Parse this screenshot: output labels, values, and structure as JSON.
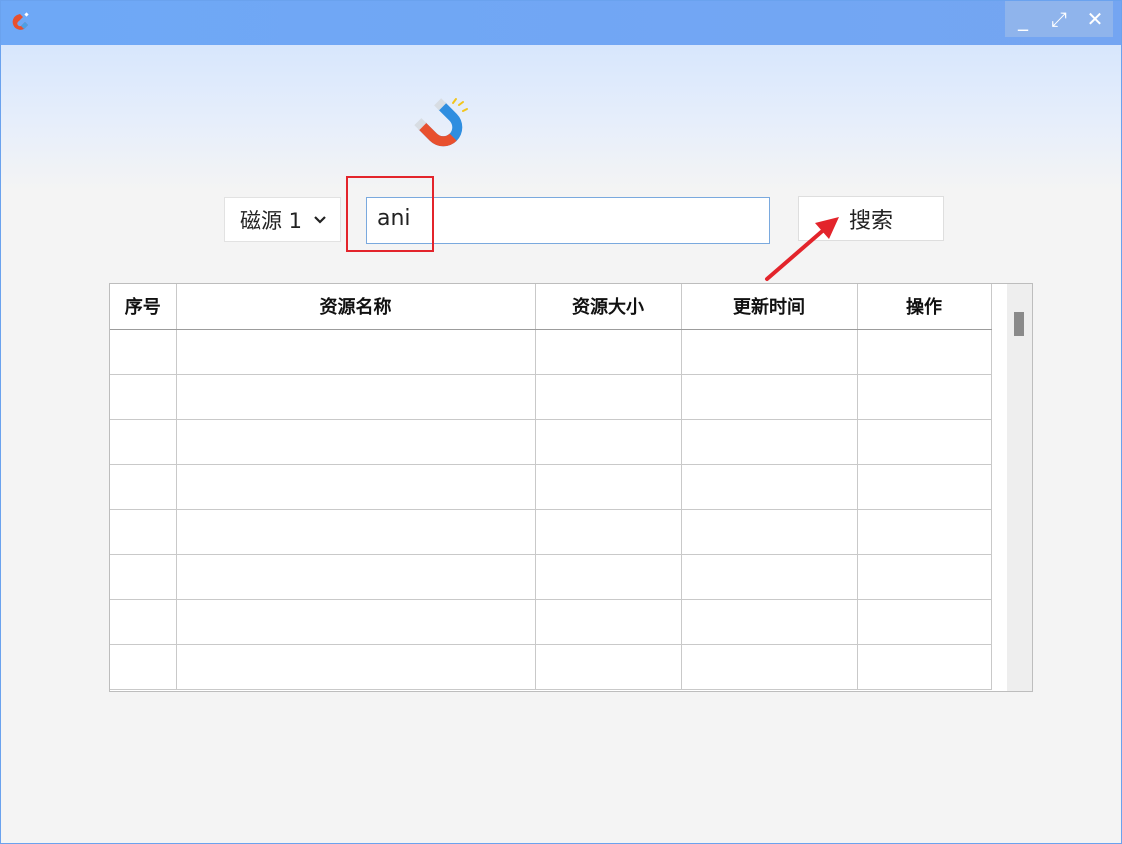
{
  "window": {
    "controls": [
      {
        "name": "minimize-button",
        "glyph": "_"
      },
      {
        "name": "maximize-button",
        "glyph": "⤢"
      },
      {
        "name": "close-button",
        "glyph": "✕"
      }
    ]
  },
  "icons": {
    "app": "magnet-icon",
    "logo": "magnet-icon"
  },
  "colors": {
    "accent": "#6ea8f6",
    "annotation": "#e3242b"
  },
  "search": {
    "source_selected": "磁源 1",
    "query": "ani",
    "button_label": "搜索"
  },
  "table": {
    "columns": [
      "序号",
      "资源名称",
      "资源大小",
      "更新时间",
      "操作"
    ],
    "rows": 8
  }
}
